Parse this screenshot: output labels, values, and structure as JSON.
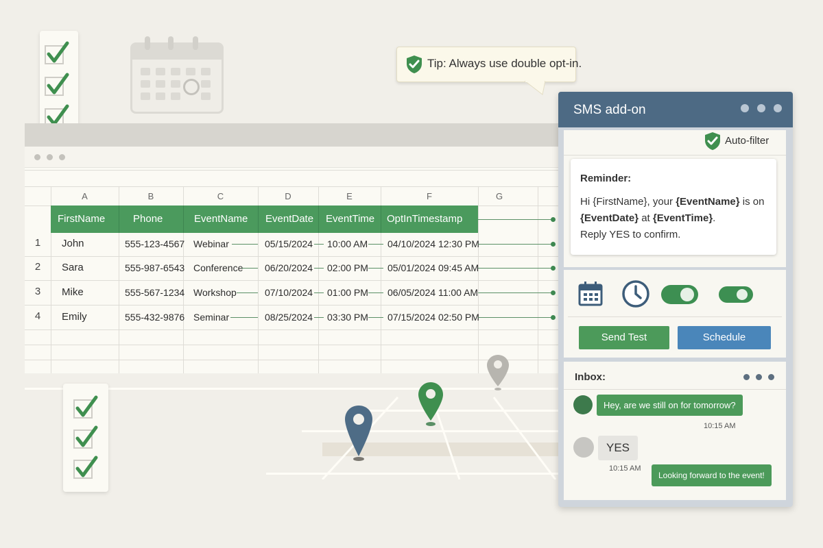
{
  "tip": {
    "text": "Tip: Always use double opt-in."
  },
  "sheet": {
    "column_letters": [
      "A",
      "B",
      "C",
      "D",
      "E",
      "F",
      "G"
    ],
    "headers": [
      "FirstName",
      "Phone",
      "EventName",
      "EventDate",
      "EventTime",
      "OptInTimestamp"
    ],
    "rows": [
      {
        "num": "1",
        "first": "John",
        "phone": "555-123-4567",
        "event": "Webinar",
        "date": "05/15/2024",
        "time": "10:00 AM",
        "optin": "04/10/2024 12:30 PM"
      },
      {
        "num": "2",
        "first": "Sara",
        "phone": "555-987-6543",
        "event": "Conference",
        "date": "06/20/2024",
        "time": "02:00 PM",
        "optin": "05/01/2024 09:45 AM"
      },
      {
        "num": "3",
        "first": "Mike",
        "phone": "555-567-1234",
        "event": "Workshop",
        "date": "07/10/2024",
        "time": "01:00 PM",
        "optin": "06/05/2024 11:00 AM"
      },
      {
        "num": "4",
        "first": "Emily",
        "phone": "555-432-9876",
        "event": "Seminar",
        "date": "08/25/2024",
        "time": "03:30 PM",
        "optin": "07/15/2024 02:50 PM"
      }
    ]
  },
  "sms": {
    "title": "SMS add-on",
    "auto_filter": "Auto-filter",
    "reminder": {
      "heading": "Reminder:",
      "line1_a": "Hi {FirstName}, your ",
      "line1_b": "{EventName}",
      "line1_c": " is on",
      "line2_a": "{EventDate}",
      "line2_b": " at ",
      "line2_c": "{EventTime}",
      "line2_d": ".",
      "line3": "Reply YES to confirm."
    },
    "send_test": "Send Test",
    "schedule": "Schedule",
    "inbox_label": "Inbox:",
    "messages": [
      {
        "text": "Hey, are we still on for tomorrow?",
        "time": "10:15 AM"
      },
      {
        "text": "YES",
        "time": "10:15 AM"
      },
      {
        "text": "Looking forward to the event!"
      }
    ]
  },
  "colors": {
    "green": "#4b9a5d",
    "blue": "#4a86ba",
    "header": "#4d6a84"
  }
}
